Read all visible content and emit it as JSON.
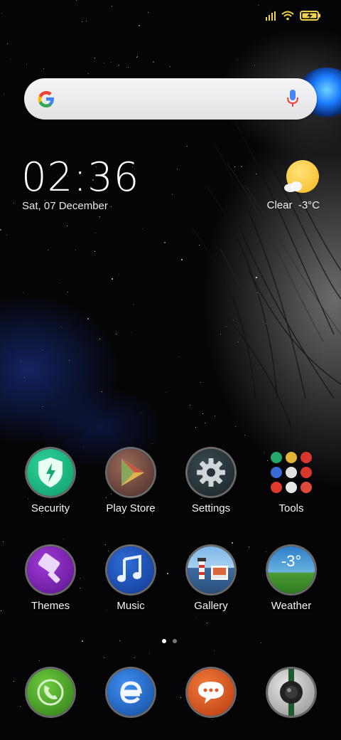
{
  "status_bar": {
    "signal_icon": "signal-bars-icon",
    "wifi_icon": "wifi-icon",
    "battery_icon": "battery-charging-icon",
    "accent_color": "#f1d34b"
  },
  "search_bar": {
    "logo_icon": "google-g-icon",
    "mic_icon": "microphone-icon"
  },
  "clock_widget": {
    "time": "02:36",
    "date": "Sat, 07 December"
  },
  "weather_widget": {
    "icon": "partly-cloudy-icon",
    "condition": "Clear",
    "temperature": "-3°C"
  },
  "apps": [
    {
      "label": "Security",
      "icon": "shield-lightning-icon"
    },
    {
      "label": "Play Store",
      "icon": "play-triangle-icon"
    },
    {
      "label": "Settings",
      "icon": "gear-icon"
    },
    {
      "label": "Tools",
      "icon": "app-folder-icon"
    },
    {
      "label": "Themes",
      "icon": "paintbrush-icon"
    },
    {
      "label": "Music",
      "icon": "music-note-icon"
    },
    {
      "label": "Gallery",
      "icon": "lighthouse-photo-icon"
    },
    {
      "label": "Weather",
      "icon": "weather-globe-icon",
      "value": "-3°"
    }
  ],
  "page_indicator": {
    "count": 2,
    "active_index": 0
  },
  "dock": [
    {
      "name": "Phone",
      "icon": "phone-icon",
      "color": "#4aa32c"
    },
    {
      "name": "Browser",
      "icon": "browser-e-icon",
      "color": "#1f6fd6"
    },
    {
      "name": "Messaging",
      "icon": "chat-bubble-icon",
      "color": "#e45a1e"
    },
    {
      "name": "Camera",
      "icon": "camera-icon",
      "color": "#bfbfbf"
    }
  ]
}
